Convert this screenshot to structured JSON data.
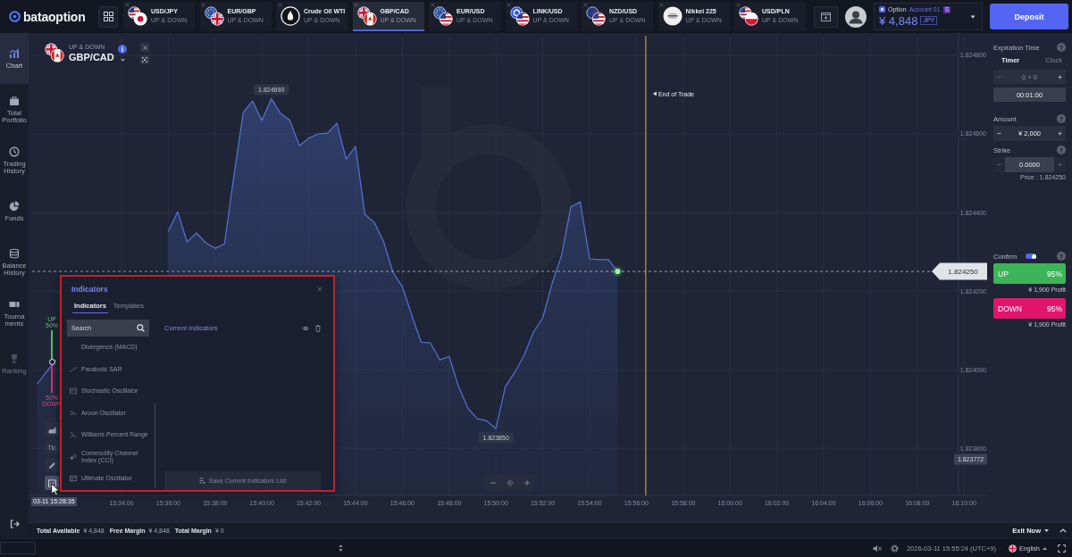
{
  "top_bar": {
    "logo": "bataoption",
    "assets": [
      {
        "name": "USD/JPY",
        "type": "UP & DOWN",
        "selected": false
      },
      {
        "name": "EUR/GBP",
        "type": "UP & DOWN",
        "selected": false
      },
      {
        "name": "Crude Oil WTI",
        "type": "UP & DOWN",
        "selected": false
      },
      {
        "name": "GBP/CAD",
        "type": "UP & DOWN",
        "selected": true
      },
      {
        "name": "EUR/USD",
        "type": "UP & DOWN",
        "selected": false
      },
      {
        "name": "LINK/USD",
        "type": "UP & DOWN",
        "selected": false
      },
      {
        "name": "NZD/USD",
        "type": "UP & DOWN",
        "selected": false
      },
      {
        "name": "Nikkei 225",
        "type": "UP & DOWN",
        "selected": false
      },
      {
        "name": "USD/PLN",
        "type": "UP & DOWN",
        "selected": false
      }
    ],
    "account": {
      "type": "Option",
      "name": "Account 01",
      "badge": "S",
      "balance": "¥ 4,848",
      "currency": "JPY"
    },
    "deposit": "Deposit"
  },
  "sidebar": {
    "items": [
      {
        "label": "Chart",
        "selected": true,
        "disabled": false
      },
      {
        "label": "Total Portfolio",
        "selected": false,
        "disabled": false
      },
      {
        "label": "Trading History",
        "selected": false,
        "disabled": false
      },
      {
        "label": "Funds",
        "selected": false,
        "disabled": false
      },
      {
        "label": "Balance History",
        "selected": false,
        "disabled": false
      },
      {
        "label": "Tournaments",
        "selected": false,
        "disabled": false
      },
      {
        "label": "Ranking",
        "selected": false,
        "disabled": true
      }
    ]
  },
  "chart_panel": {
    "asset_type": "UP & DOWN",
    "asset": "GBP/CAD",
    "chart_data": {
      "type": "area",
      "grid": true,
      "categories": [
        null,
        null,
        null,
        null,
        null,
        null,
        null,
        null,
        null,
        "15:34:00",
        null,
        null,
        null,
        null,
        "15:36:00",
        null,
        null,
        null,
        null,
        "15:38:00",
        null,
        null,
        null,
        null,
        "15:40:00",
        null,
        null,
        null,
        null,
        "15:42:00",
        null,
        null,
        null,
        null,
        "15:44:00",
        null,
        null,
        null,
        null,
        "15:46:00",
        null,
        null,
        null,
        null,
        "15:48:00",
        null,
        null,
        null,
        null,
        "15:50:00",
        null,
        null,
        null,
        null,
        "15:52:00",
        null,
        null,
        null,
        null,
        "15:54:00",
        null,
        null,
        null,
        null,
        "15:56:00",
        null,
        null,
        null,
        null,
        "15:58:00",
        null,
        null,
        null,
        null,
        "16:00:00",
        null,
        null,
        null,
        null,
        "16:02:00",
        null,
        null,
        null,
        null,
        "16:04:00",
        null,
        null,
        null,
        null,
        "16:06:00",
        null,
        null,
        null,
        null,
        "16:08:00",
        null,
        null,
        null,
        null,
        "16:10:00"
      ],
      "values": [
        1.823964,
        1.823995,
        1.824025,
        null,
        null,
        null,
        null,
        null,
        null,
        null,
        null,
        null,
        null,
        null,
        1.824352,
        1.824402,
        1.824325,
        1.824348,
        1.824323,
        1.824309,
        1.82432,
        1.824493,
        1.824655,
        1.824684,
        1.824634,
        1.82469,
        1.824652,
        1.824634,
        1.82457,
        1.824589,
        1.8246,
        1.824602,
        1.824627,
        1.824536,
        1.824568,
        1.824395,
        1.824375,
        1.824325,
        1.824248,
        1.824211,
        1.824139,
        1.82407,
        1.824068,
        1.824025,
        1.824034,
        1.823957,
        1.823902,
        1.823875,
        1.82387,
        1.82385,
        1.823957,
        1.823993,
        1.824036,
        1.824095,
        1.824132,
        1.82422,
        1.824291,
        1.824414,
        1.824427,
        1.824282,
        1.82428,
        1.82428,
        1.82425,
        null,
        null,
        null,
        null,
        null,
        null,
        null,
        null,
        null,
        null,
        null,
        null,
        null,
        null,
        null,
        null,
        null,
        null,
        null,
        null,
        null,
        null,
        null,
        null,
        null,
        null,
        null,
        null,
        null,
        null,
        null,
        null,
        null,
        null,
        null,
        null,
        null
      ],
      "ylim": [
        1.82368,
        1.82485
      ],
      "yticks": [
        {
          "value": 1.8248,
          "label": "1.824800"
        },
        {
          "value": 1.8246,
          "label": "1.824600"
        },
        {
          "value": 1.8244,
          "label": "1.824400"
        },
        {
          "value": 1.8242,
          "label": "1.824200"
        },
        {
          "value": 1.824,
          "label": "1.824000"
        },
        {
          "value": 1.8238,
          "label": "1.823800"
        }
      ],
      "annotations": [
        {
          "y": 1.82469,
          "text": "1.824690"
        },
        {
          "y": 1.82385,
          "text": "1.823850"
        },
        "1.823772"
      ],
      "ref_lines": [
        {
          "axis": "y",
          "value": 1.82425,
          "label": "1.824250"
        }
      ]
    },
    "end_of_trade": "End of Trade",
    "sentiment": {
      "up_label": "UP",
      "up_share": "50%",
      "down_share": "50%",
      "down_label": "DOWN",
      "level": 0.5
    },
    "tools": [
      {
        "kind": "icon",
        "selected": false
      },
      {
        "kind": "text",
        "label": "Tic",
        "selected": false
      },
      {
        "kind": "icon",
        "selected": false
      },
      {
        "kind": "icon",
        "selected": true
      }
    ],
    "crosshair_time": "03-11 15:28:35"
  },
  "indicators_panel": {
    "title": "Indicators",
    "tabs": [
      {
        "label": "Indicators",
        "selected": true
      },
      {
        "label": "Templates",
        "selected": false
      }
    ],
    "search": {
      "placeholder": "Search"
    },
    "items": [
      {
        "label": "Divergence (MACD)"
      },
      {
        "label": "Parabolic SAR"
      },
      {
        "label": "Stochastic Oscillator"
      },
      {
        "label": "Aroon Oscillator"
      },
      {
        "label": "Williams Percent Range"
      },
      {
        "label": "Commodity Channel Index (CCI)"
      },
      {
        "label": "Ultimate Oscillator"
      }
    ],
    "current_title": "Current Indicators",
    "save_button": {
      "label": "Save Current Indicators List",
      "disabled": true
    }
  },
  "trade_panel": {
    "expiration": {
      "label": "Expiration Time",
      "help": "?",
      "modes": [
        {
          "label": "Timer",
          "selected": true
        },
        {
          "label": "Clock",
          "selected": false
        }
      ],
      "offset": {
        "value": "0 + 0",
        "disabled": true,
        "buttons_disabled": false
      },
      "duration": "00:01:00"
    },
    "amount": {
      "label": "Amount",
      "help": "?",
      "value": "¥ 2,000",
      "disabled": false,
      "buttons_disabled": false
    },
    "strike": {
      "label": "Strike",
      "help": "?",
      "value": "0.0000",
      "disabled": false,
      "buttons_disabled": true
    },
    "price": "Price : 1.824250",
    "confirm": {
      "label": "Confirm",
      "on": true,
      "help": "?"
    },
    "actions": [
      {
        "kind": "up",
        "label": "UP",
        "payout": "95%",
        "profit": "¥ 1,900 Profit"
      },
      {
        "kind": "down",
        "label": "DOWN",
        "payout": "95%",
        "profit": "¥ 1,900 Profit"
      }
    ]
  },
  "status_bar": {
    "items": [
      {
        "label": "Total Available",
        "value": "¥ 4,848"
      },
      {
        "label": "Free Margin",
        "value": "¥ 4,848"
      },
      {
        "label": "Total Margin",
        "value": "¥ 0"
      }
    ],
    "exit": "Exit Now"
  },
  "footer": {
    "datetime": "2026-03-11 15:55:24 (UTC+9)",
    "language": "English"
  }
}
